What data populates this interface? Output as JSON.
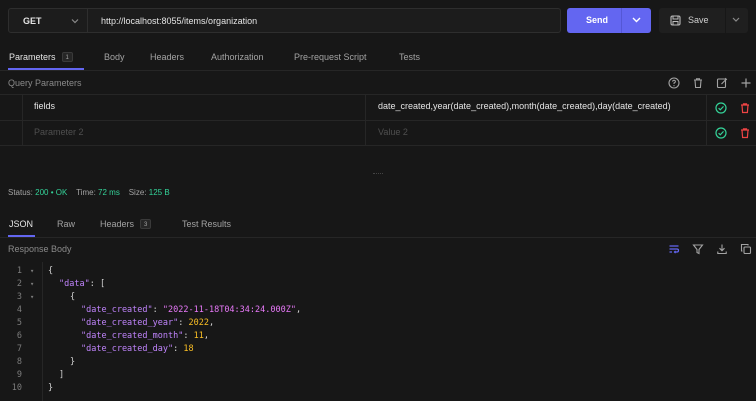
{
  "request": {
    "method": "GET",
    "url": "http://localhost:8055/items/organization",
    "send_label": "Send",
    "save_label": "Save"
  },
  "request_tabs": [
    {
      "label": "Parameters",
      "badge": "1",
      "active": true
    },
    {
      "label": "Body"
    },
    {
      "label": "Headers"
    },
    {
      "label": "Authorization"
    },
    {
      "label": "Pre-request Script"
    },
    {
      "label": "Tests"
    }
  ],
  "query_params": {
    "label": "Query Parameters",
    "tools": [
      "help-icon",
      "trash-icon",
      "edit-icon",
      "plus-icon"
    ],
    "rows": [
      {
        "key": "fields",
        "value": "date_created,year(date_created),month(date_created),day(date_created)"
      }
    ],
    "placeholder": {
      "key": "Parameter 2",
      "value": "Value 2"
    }
  },
  "response": {
    "status_label": "Status:",
    "status_code": "200",
    "status_text": "OK",
    "time_label": "Time:",
    "time_value": "72 ms",
    "size_label": "Size:",
    "size_value": "125 B",
    "tabs": [
      {
        "label": "JSON",
        "active": true
      },
      {
        "label": "Raw"
      },
      {
        "label": "Headers",
        "badge": "3"
      },
      {
        "label": "Test Results"
      }
    ],
    "body_label": "Response Body",
    "tools": [
      "wrap-icon",
      "filter-icon",
      "download-icon",
      "copy-icon"
    ],
    "code": {
      "line_numbers": [
        "1",
        "2",
        "3",
        "4",
        "5",
        "6",
        "7",
        "8",
        "9",
        "10"
      ],
      "open_brace": "{",
      "data_key": "\"data\"",
      "colon_bracket": ": [",
      "inner_open": "{",
      "date_created_key": "\"date_created\"",
      "date_created_val": "\"2022-11-18T04:34:24.000Z\"",
      "year_key": "\"date_created_year\"",
      "year_val": "2022",
      "month_key": "\"date_created_month\"",
      "month_val": "11",
      "day_key": "\"date_created_day\"",
      "day_val": "18",
      "inner_close": "}",
      "array_close": "]",
      "close_brace": "}"
    }
  },
  "colors": {
    "accent": "#6366f1",
    "ok": "#34d399",
    "delete": "#ef4444"
  }
}
